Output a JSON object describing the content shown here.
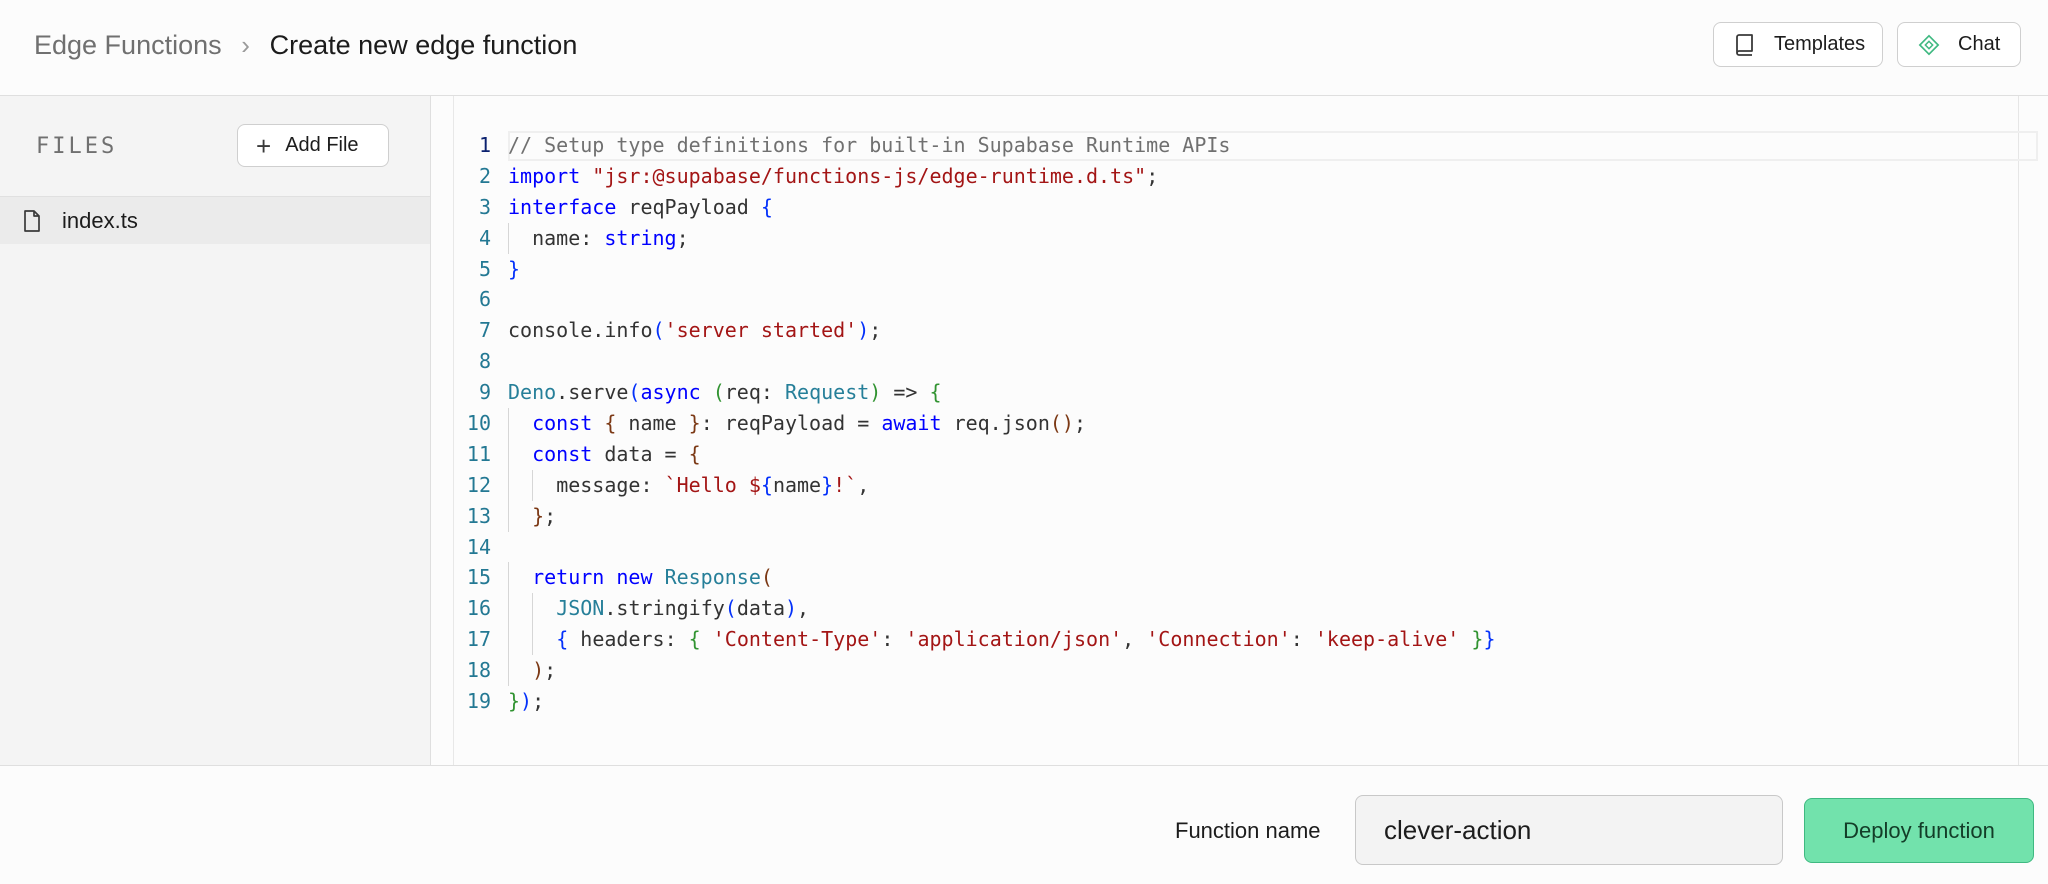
{
  "breadcrumb": {
    "parent": "Edge Functions",
    "separator": "›",
    "current": "Create new edge function"
  },
  "header_buttons": {
    "templates_label": "Templates",
    "chat_label": "Chat",
    "templates_icon": "book-icon",
    "chat_icon": "diamond-icon"
  },
  "sidebar": {
    "title": "FILES",
    "add_file_label": "Add File",
    "files": [
      {
        "name": "index.ts",
        "icon": "file-icon"
      }
    ]
  },
  "editor": {
    "active_line": 1,
    "lines": [
      [
        [
          "// Setup type definitions for built-in Supabase Runtime APIs",
          "comment"
        ]
      ],
      [
        [
          "import ",
          "kw"
        ],
        [
          "\"jsr:@supabase/functions-js/edge-runtime.d.ts\"",
          "str"
        ],
        [
          ";",
          "plain"
        ]
      ],
      [
        [
          "interface ",
          "kw"
        ],
        [
          "reqPayload ",
          "plain"
        ],
        [
          "{",
          "b1"
        ]
      ],
      [
        [
          "  ",
          "guide"
        ],
        [
          "name: ",
          "plain"
        ],
        [
          "string",
          "kw"
        ],
        [
          ";",
          "plain"
        ]
      ],
      [
        [
          "}",
          "b1"
        ]
      ],
      [],
      [
        [
          "console.info",
          "plain"
        ],
        [
          "(",
          "b1"
        ],
        [
          "'server started'",
          "str"
        ],
        [
          ")",
          "b1"
        ],
        [
          ";",
          "plain"
        ]
      ],
      [],
      [
        [
          "Deno",
          "type"
        ],
        [
          ".serve",
          "plain"
        ],
        [
          "(",
          "b1"
        ],
        [
          "async ",
          "kw"
        ],
        [
          "(",
          "b2"
        ],
        [
          "req: ",
          "plain"
        ],
        [
          "Request",
          "type"
        ],
        [
          ")",
          "b2"
        ],
        [
          " => ",
          "plain"
        ],
        [
          "{",
          "b2"
        ]
      ],
      [
        [
          "  ",
          "guide"
        ],
        [
          "const ",
          "kw"
        ],
        [
          "{",
          "b3"
        ],
        [
          " name ",
          "plain"
        ],
        [
          "}",
          "b3"
        ],
        [
          ": reqPayload = ",
          "plain"
        ],
        [
          "await ",
          "kw"
        ],
        [
          "req.json",
          "plain"
        ],
        [
          "()",
          "b3"
        ],
        [
          ";",
          "plain"
        ]
      ],
      [
        [
          "  ",
          "guide"
        ],
        [
          "const ",
          "kw"
        ],
        [
          "data = ",
          "plain"
        ],
        [
          "{",
          "b3"
        ]
      ],
      [
        [
          "  ",
          "guide"
        ],
        [
          "  ",
          "guide"
        ],
        [
          "message: ",
          "plain"
        ],
        [
          "`Hello $",
          "str"
        ],
        [
          "{",
          "b1"
        ],
        [
          "name",
          "plain"
        ],
        [
          "}",
          "b1"
        ],
        [
          "!`",
          "str"
        ],
        [
          ",",
          "plain"
        ]
      ],
      [
        [
          "  ",
          "guide"
        ],
        [
          "}",
          "b3"
        ],
        [
          ";",
          "plain"
        ]
      ],
      [],
      [
        [
          "  ",
          "guide"
        ],
        [
          "return ",
          "kw"
        ],
        [
          "new ",
          "kw"
        ],
        [
          "Response",
          "type"
        ],
        [
          "(",
          "b3"
        ]
      ],
      [
        [
          "  ",
          "guide"
        ],
        [
          "  ",
          "guide"
        ],
        [
          "JSON",
          "type"
        ],
        [
          ".stringify",
          "plain"
        ],
        [
          "(",
          "b1"
        ],
        [
          "data",
          "plain"
        ],
        [
          ")",
          "b1"
        ],
        [
          ",",
          "plain"
        ]
      ],
      [
        [
          "  ",
          "guide"
        ],
        [
          "  ",
          "guide"
        ],
        [
          "{",
          "b1"
        ],
        [
          " headers: ",
          "plain"
        ],
        [
          "{",
          "b2"
        ],
        [
          " ",
          "plain"
        ],
        [
          "'Content-Type'",
          "str"
        ],
        [
          ": ",
          "plain"
        ],
        [
          "'application/json'",
          "str"
        ],
        [
          ", ",
          "plain"
        ],
        [
          "'Connection'",
          "str"
        ],
        [
          ": ",
          "plain"
        ],
        [
          "'keep-alive'",
          "str"
        ],
        [
          " ",
          "plain"
        ],
        [
          "}",
          "b2"
        ],
        [
          "}",
          "b1"
        ]
      ],
      [
        [
          "  ",
          "guide"
        ],
        [
          ")",
          "b3"
        ],
        [
          ";",
          "plain"
        ]
      ],
      [
        [
          "}",
          "b2"
        ],
        [
          ")",
          "b1"
        ],
        [
          ";",
          "plain"
        ]
      ]
    ]
  },
  "footer": {
    "function_name_label": "Function name",
    "function_name_value": "clever-action",
    "deploy_label": "Deploy function"
  },
  "colors": {
    "deploy_bg": "#72e2ac",
    "line_number": "#237893",
    "keyword": "#0000ff",
    "string": "#a31515"
  }
}
